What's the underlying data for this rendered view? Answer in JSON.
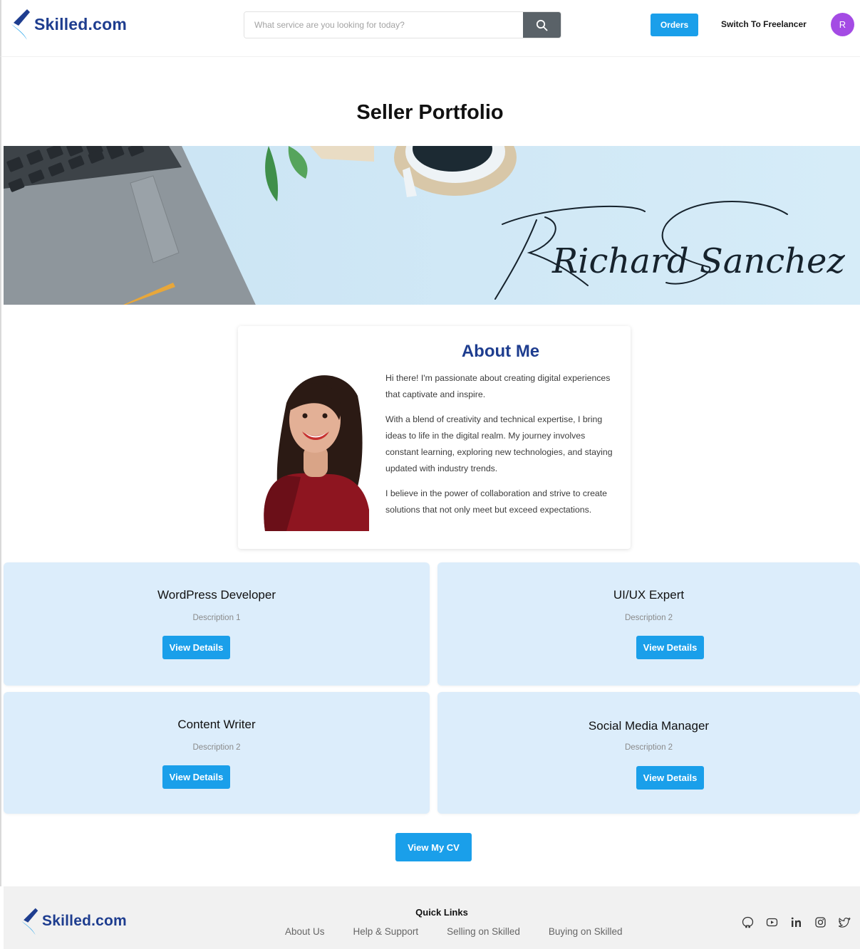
{
  "brand": {
    "name": "Skilled.com",
    "color": "#1e3d8f",
    "accent": "#1a9fea"
  },
  "header": {
    "search_placeholder": "What service are you looking for today?",
    "search_icon": "search-icon",
    "orders_label": "Orders",
    "switch_label": "Switch To Freelancer",
    "avatar_initial": "R",
    "avatar_color": "#a44be4"
  },
  "page": {
    "title": "Seller Portfolio"
  },
  "banner": {
    "signature": "Richard Sanchez"
  },
  "about": {
    "title": "About Me",
    "paragraphs": [
      "Hi there! I'm passionate about creating digital experiences that captivate and inspire.",
      "With a blend of creativity and technical expertise, I bring ideas to life in the digital realm. My journey involves constant learning, exploring new technologies, and staying updated with industry trends.",
      "I believe in the power of collaboration and strive to create solutions that not only meet but exceed expectations."
    ]
  },
  "skills": [
    {
      "title": "WordPress Developer",
      "description": "Description 1",
      "button": "View Details"
    },
    {
      "title": "UI/UX Expert",
      "description": "Description 2",
      "button": "View Details"
    },
    {
      "title": "Content Writer",
      "description": "Description 2",
      "button": "View Details"
    },
    {
      "title": "Social Media Manager",
      "description": "Description 2",
      "button": "View Details"
    }
  ],
  "cv_button": "View My CV",
  "footer": {
    "quick_links_title": "Quick Links",
    "links": [
      "About Us",
      "Help & Support",
      "Selling on Skilled",
      "Buying on Skilled"
    ],
    "socials": [
      "github-icon",
      "youtube-icon",
      "linkedin-icon",
      "instagram-icon",
      "twitter-icon"
    ]
  }
}
